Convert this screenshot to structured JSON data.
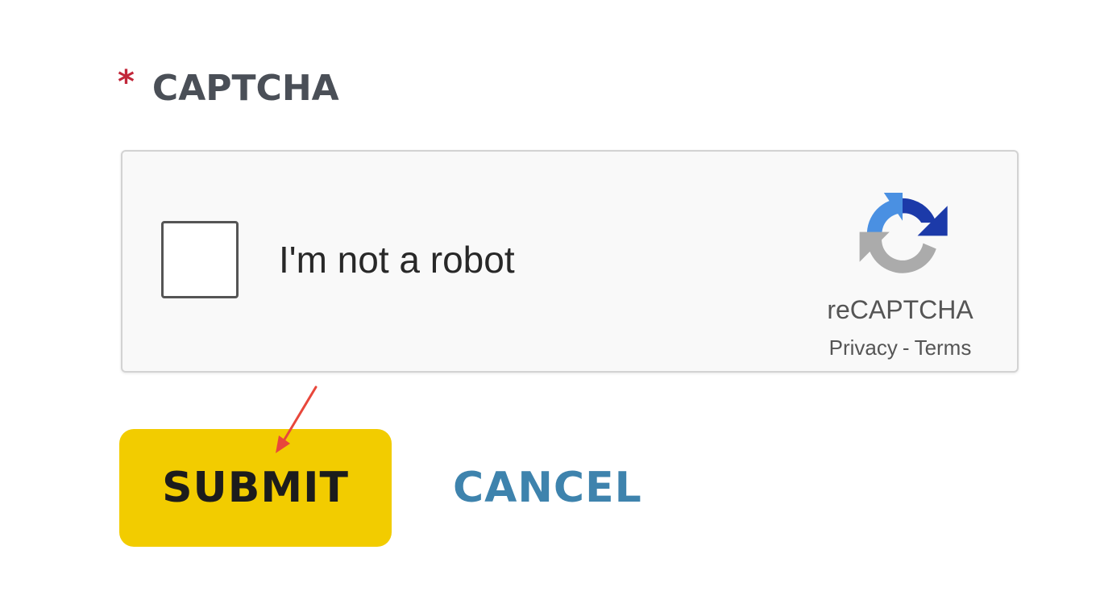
{
  "captcha_field": {
    "required_mark": "*",
    "label": "CAPTCHA"
  },
  "recaptcha": {
    "checkbox_label": "I'm not a robot",
    "checked": false,
    "brand_name": "reCAPTCHA",
    "privacy_link": "Privacy",
    "separator": "-",
    "terms_link": "Terms",
    "logo_colors": {
      "light_blue": "#4a90e2",
      "dark_blue": "#1c3aa9",
      "gray": "#ababab"
    }
  },
  "actions": {
    "submit_label": "SUBMIT",
    "cancel_label": "CANCEL"
  },
  "colors": {
    "submit_bg": "#f2cc00",
    "cancel_text": "#3e83ad",
    "required_mark": "#c2273a",
    "annotation_arrow": "#e8473b"
  }
}
